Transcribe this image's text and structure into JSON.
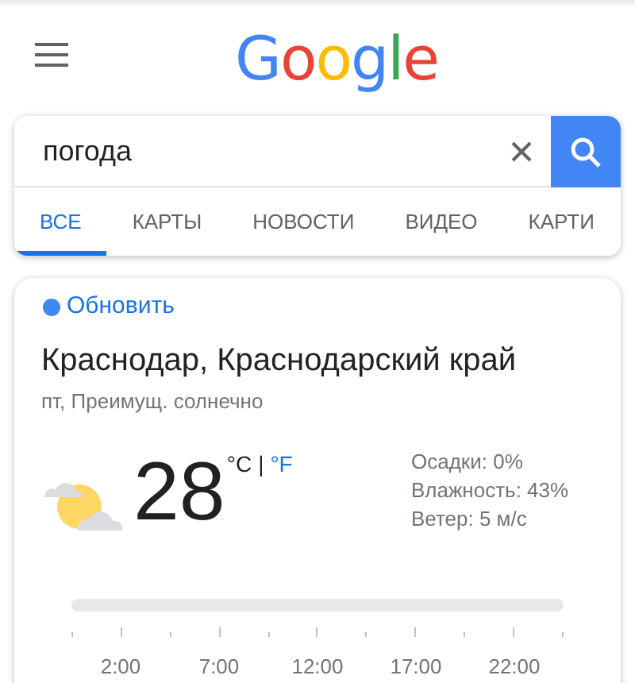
{
  "header": {
    "logo": "Google"
  },
  "search": {
    "value": "погода"
  },
  "tabs": [
    {
      "label": "ВСЕ",
      "selected": true
    },
    {
      "label": "КАРТЫ",
      "selected": false
    },
    {
      "label": "НОВОСТИ",
      "selected": false
    },
    {
      "label": "ВИДЕО",
      "selected": false
    },
    {
      "label": "КАРТИ",
      "selected": false
    }
  ],
  "weather": {
    "refresh": "Обновить",
    "location": "Краснодар, Краснодарский край",
    "condition": "пт, Преимущ. солнечно",
    "temperature": "28",
    "unit_c": "°C",
    "separator": "|",
    "unit_f": "°F",
    "details": [
      "Осадки: 0%",
      "Влажность: 43%",
      "Ветер: 5 м/с"
    ],
    "times": [
      "2:00",
      "7:00",
      "12:00",
      "17:00",
      "22:00"
    ]
  }
}
